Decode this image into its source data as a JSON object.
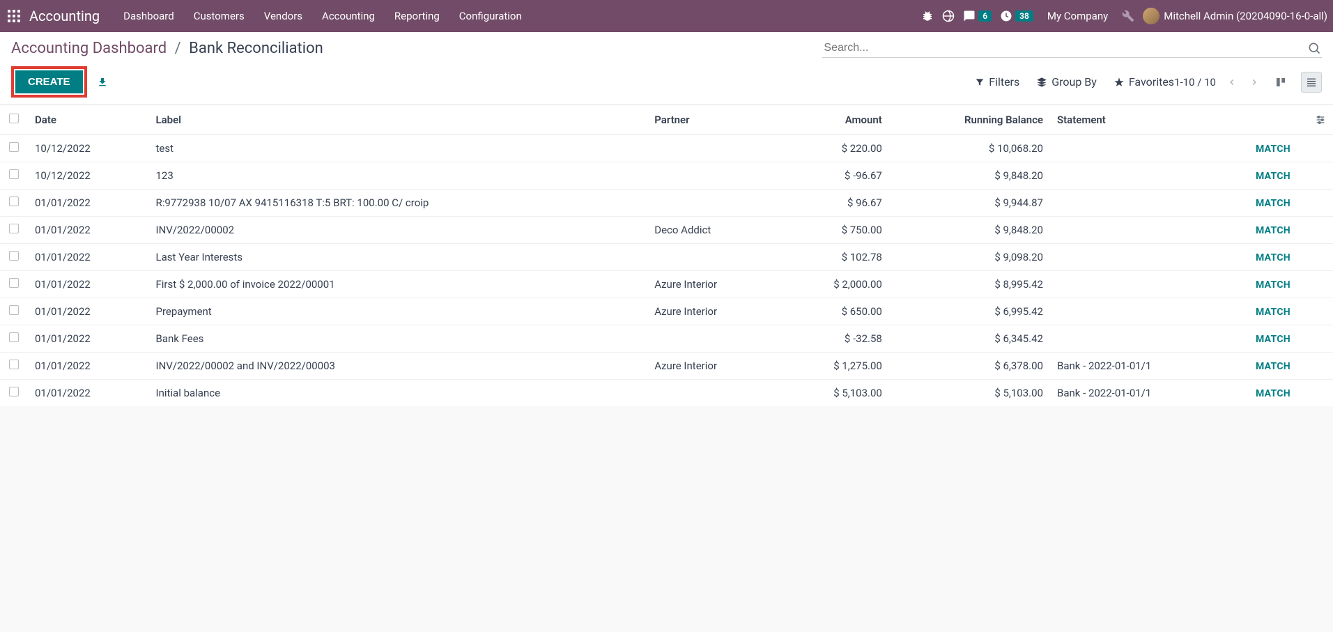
{
  "navbar": {
    "brand": "Accounting",
    "menu": [
      "Dashboard",
      "Customers",
      "Vendors",
      "Accounting",
      "Reporting",
      "Configuration"
    ],
    "conversations_badge": "6",
    "activities_badge": "38",
    "company": "My Company",
    "user": "Mitchell Admin (20204090-16-0-all)"
  },
  "breadcrumb": {
    "parent": "Accounting Dashboard",
    "current": "Bank Reconciliation"
  },
  "search": {
    "placeholder": "Search..."
  },
  "toolbar": {
    "create": "CREATE",
    "filters": "Filters",
    "groupby": "Group By",
    "favorites": "Favorites",
    "pager": "1-10 / 10"
  },
  "columns": {
    "date": "Date",
    "label": "Label",
    "partner": "Partner",
    "amount": "Amount",
    "running_balance": "Running Balance",
    "statement": "Statement"
  },
  "match_label": "MATCH",
  "rows": [
    {
      "date": "10/12/2022",
      "label": "test",
      "partner": "",
      "amount": "$ 220.00",
      "running": "$ 10,068.20",
      "statement": ""
    },
    {
      "date": "10/12/2022",
      "label": "123",
      "partner": "",
      "amount": "$ -96.67",
      "running": "$ 9,848.20",
      "statement": ""
    },
    {
      "date": "01/01/2022",
      "label": "R:9772938 10/07 AX 9415116318 T:5 BRT: 100.00 C/ croip",
      "partner": "",
      "amount": "$ 96.67",
      "running": "$ 9,944.87",
      "statement": ""
    },
    {
      "date": "01/01/2022",
      "label": "INV/2022/00002",
      "partner": "Deco Addict",
      "amount": "$ 750.00",
      "running": "$ 9,848.20",
      "statement": ""
    },
    {
      "date": "01/01/2022",
      "label": "Last Year Interests",
      "partner": "",
      "amount": "$ 102.78",
      "running": "$ 9,098.20",
      "statement": ""
    },
    {
      "date": "01/01/2022",
      "label": "First $ 2,000.00 of invoice 2022/00001",
      "partner": "Azure Interior",
      "amount": "$ 2,000.00",
      "running": "$ 8,995.42",
      "statement": ""
    },
    {
      "date": "01/01/2022",
      "label": "Prepayment",
      "partner": "Azure Interior",
      "amount": "$ 650.00",
      "running": "$ 6,995.42",
      "statement": ""
    },
    {
      "date": "01/01/2022",
      "label": "Bank Fees",
      "partner": "",
      "amount": "$ -32.58",
      "running": "$ 6,345.42",
      "statement": ""
    },
    {
      "date": "01/01/2022",
      "label": "INV/2022/00002 and INV/2022/00003",
      "partner": "Azure Interior",
      "amount": "$ 1,275.00",
      "running": "$ 6,378.00",
      "statement": "Bank - 2022-01-01/1"
    },
    {
      "date": "01/01/2022",
      "label": "Initial balance",
      "partner": "",
      "amount": "$ 5,103.00",
      "running": "$ 5,103.00",
      "statement": "Bank - 2022-01-01/1"
    }
  ]
}
